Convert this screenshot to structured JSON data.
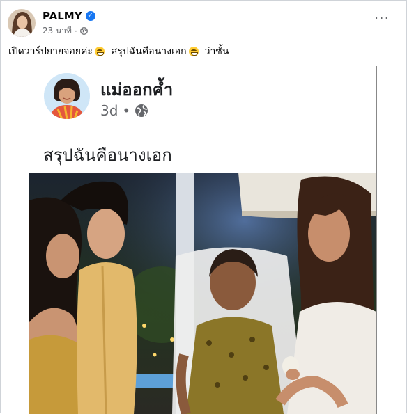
{
  "post": {
    "author": "PALMY",
    "time": "23 นาที",
    "caption_part1": "เปิดวาร์ปยายจอยค่ะ",
    "caption_part2": "สรุปฉันคือนางเอก",
    "caption_part3": "ว่าซั้น",
    "more_label": "···"
  },
  "shared": {
    "author": "แม่ออกค้ำ",
    "time": "3d",
    "text": "สรุปฉันคือนางเอก"
  },
  "icons": {
    "verified": "verified-badge-icon",
    "globe": "globe-icon",
    "more": "more-options-icon",
    "emoji": "grinning-face-emoji"
  },
  "colors": {
    "accent": "#1877f2",
    "secondary_text": "#65676b",
    "primary_text": "#050505"
  }
}
